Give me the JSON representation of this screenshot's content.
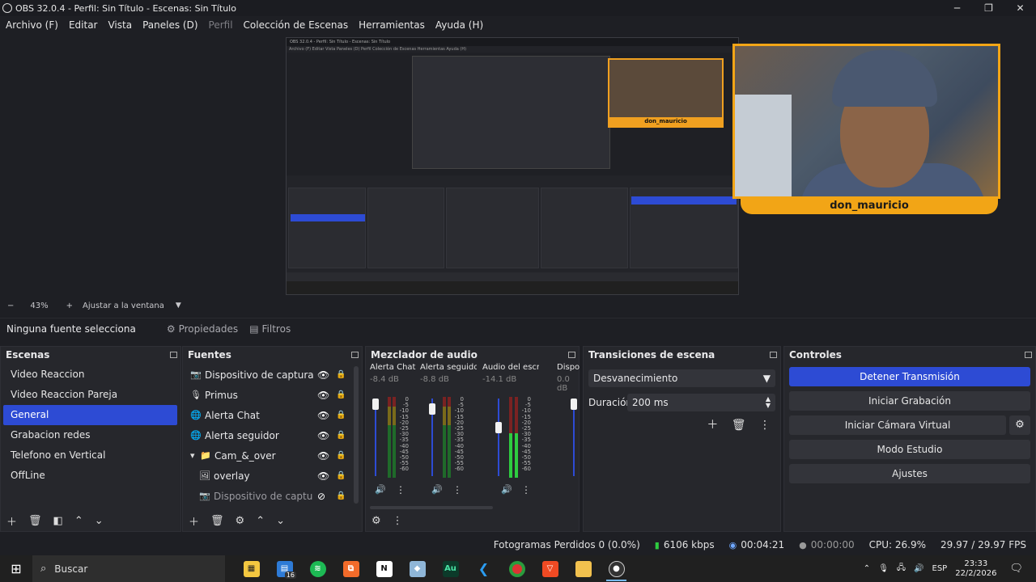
{
  "window": {
    "title": "OBS 32.0.4 - Perfil: Sin Título - Escenas: Sin Título",
    "minimize": "─",
    "maximize": "❐",
    "close": "✕"
  },
  "menu": [
    {
      "label": "Archivo (F)",
      "disabled": false
    },
    {
      "label": "Editar",
      "disabled": false
    },
    {
      "label": "Vista",
      "disabled": false
    },
    {
      "label": "Paneles (D)",
      "disabled": false
    },
    {
      "label": "Perfil",
      "disabled": true
    },
    {
      "label": "Colección de Escenas",
      "disabled": false
    },
    {
      "label": "Herramientas",
      "disabled": false
    },
    {
      "label": "Ayuda (H)",
      "disabled": false
    }
  ],
  "preview": {
    "webcam_name": "don_mauricio",
    "mini_name": "don_mauricio",
    "mini_title": "OBS 32.0.4 - Perfil: Sin Título - Escenas: Sin Título",
    "mini_menu": "Archivo (F)  Editar  Vista  Paneles (D)  Perfil  Colección de Escenas  Herramientas  Ayuda (H)"
  },
  "zoom": {
    "minus": "−",
    "level": "43%",
    "plus": "+",
    "fit_label": "Ajustar a la ventana",
    "caret": "▼"
  },
  "source_bar": {
    "no_selection": "Ninguna fuente selecciona",
    "properties": "Propiedades",
    "filters": "Filtros"
  },
  "scenes": {
    "title": "Escenas",
    "items": [
      {
        "label": "Video Reaccion",
        "active": false
      },
      {
        "label": "Video Reaccion Pareja",
        "active": false
      },
      {
        "label": "General",
        "active": true
      },
      {
        "label": "Grabacion redes",
        "active": false
      },
      {
        "label": "Telefono en Vertical",
        "active": false
      },
      {
        "label": "OffLine",
        "active": false
      }
    ]
  },
  "sources": {
    "title": "Fuentes",
    "items": [
      {
        "label": "Dispositivo de captura de video",
        "icon": "camera-icon",
        "visible": true,
        "dim": false
      },
      {
        "label": "Primus",
        "icon": "microphone-icon",
        "visible": true,
        "dim": false
      },
      {
        "label": "Alerta Chat",
        "icon": "globe-icon",
        "visible": true,
        "dim": false
      },
      {
        "label": "Alerta seguidor",
        "icon": "globe-icon",
        "visible": true,
        "dim": false
      },
      {
        "label": "Cam_&_over",
        "icon": "folder-icon",
        "visible": true,
        "dim": false
      },
      {
        "label": "overlay",
        "icon": "image-icon",
        "visible": true,
        "dim": false
      },
      {
        "label": "Dispositivo de captura de video",
        "icon": "camera-icon",
        "visible": false,
        "dim": true
      }
    ]
  },
  "mixer": {
    "title": "Mezclador de audio",
    "channels": [
      {
        "name": "Alerta Chat",
        "db": "-8.4 dB",
        "level": 1.0
      },
      {
        "name": "Alerta seguidor",
        "db": "-8.8 dB",
        "level": 0.93
      },
      {
        "name": "Audio del escritorio",
        "db": "-14.1 dB",
        "level": 0.68
      },
      {
        "name": "Dispositivo",
        "db": "0.0 dB",
        "level": 1.0
      }
    ],
    "scale": [
      "0",
      "-5",
      "-10",
      "-15",
      "-20",
      "-25",
      "-30",
      "-35",
      "-40",
      "-45",
      "-50",
      "-55",
      "-60"
    ]
  },
  "transitions": {
    "title": "Transiciones de escena",
    "selected": "Desvanecimiento",
    "duration_label": "Duración",
    "duration_value": "200 ms"
  },
  "controls": {
    "title": "Controles",
    "stop_stream": "Detener Transmisión",
    "start_recording": "Iniciar Grabación",
    "start_virtual_cam": "Iniciar Cámara Virtual",
    "studio_mode": "Modo Estudio",
    "settings": "Ajustes"
  },
  "status": {
    "dropped_frames": "Fotogramas Perdidos 0 (0.0%)",
    "bitrate": "6106 kbps",
    "stream_time": "00:04:21",
    "record_time": "00:00:00",
    "cpu": "CPU: 26.9%",
    "fps": "29.97 / 29.97 FPS"
  },
  "taskbar": {
    "search_placeholder": "Buscar",
    "badge_count": "16",
    "language": "ESP",
    "time": "23:33",
    "date": "22/2/2026"
  },
  "colors": {
    "accent": "#2d4bd4",
    "overlay_orange": "#f2a516",
    "meter_green": "#2ecc40"
  }
}
